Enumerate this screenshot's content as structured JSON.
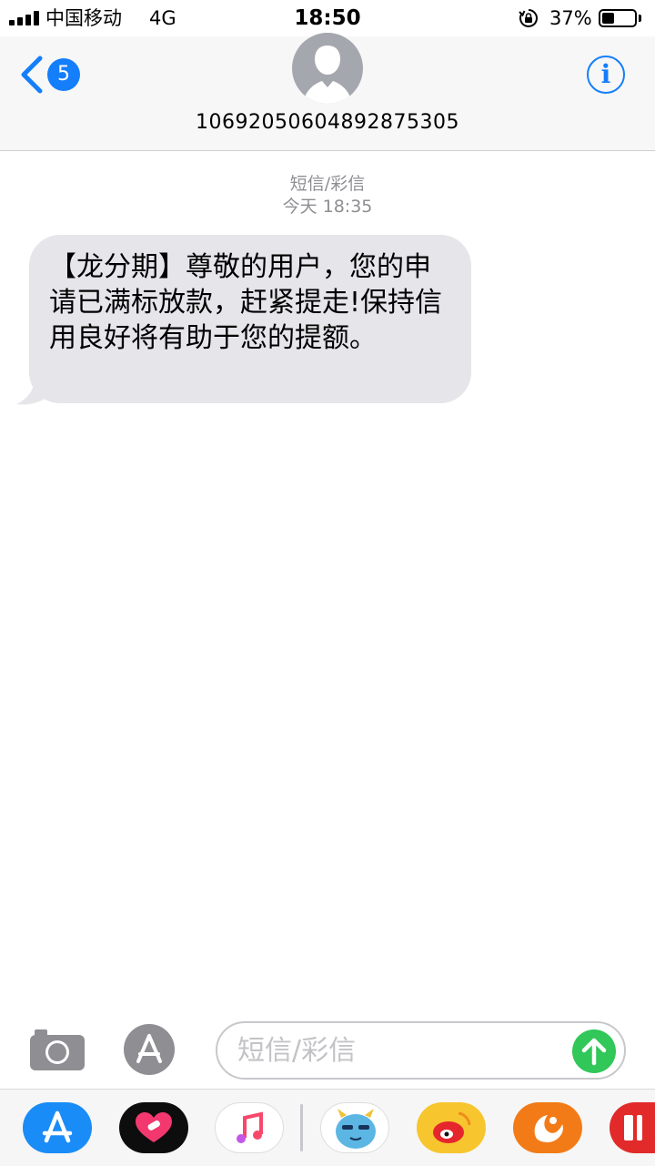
{
  "status_bar": {
    "carrier": "中国移动",
    "network": "4G",
    "time": "18:50",
    "battery_percent": "37%",
    "battery_level": 0.37
  },
  "header": {
    "unread_count": "5",
    "contact_number": "10692050604892875305",
    "info_label": "i"
  },
  "conversation": {
    "message_type": "短信/彩信",
    "timestamp": "今天 18:35",
    "messages": [
      {
        "direction": "incoming",
        "text": "【龙分期】尊敬的用户，您的申请已满标放款，赶紧提走!保持信用良好将有助于您的提额。"
      }
    ]
  },
  "input_bar": {
    "placeholder": "短信/彩信",
    "value": ""
  },
  "app_drawer": {
    "apps": [
      {
        "icon": "app-store-icon"
      },
      {
        "icon": "health-app-icon"
      },
      {
        "icon": "music-app-icon"
      },
      {
        "icon": "blue-monster-app-icon"
      },
      {
        "icon": "weibo-app-icon"
      },
      {
        "icon": "uc-browser-app-icon"
      },
      {
        "icon": "red-app-icon"
      }
    ]
  },
  "colors": {
    "accent": "#147efb",
    "bubble": "#e5e5ea",
    "send": "#31c759",
    "meta_text": "#8e8e93"
  }
}
